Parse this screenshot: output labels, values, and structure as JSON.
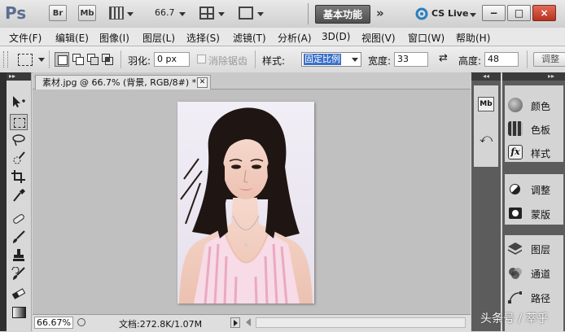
{
  "app": {
    "logo": "Ps",
    "bridge_label": "Br",
    "minibridge_label": "Mb",
    "zoom_value": "66.7",
    "workspace_label": "基本功能",
    "more_glyph": "»",
    "cs_live_label": "CS Live",
    "window_controls": [
      "−",
      "□",
      "×"
    ]
  },
  "menu": [
    "文件(F)",
    "编辑(E)",
    "图像(I)",
    "图层(L)",
    "选择(S)",
    "滤镜(T)",
    "分析(A)",
    "3D(D)",
    "视图(V)",
    "窗口(W)",
    "帮助(H)"
  ],
  "options": {
    "feather_label": "羽化:",
    "feather_value": "0 px",
    "antialias_label": "消除锯齿",
    "style_label": "样式:",
    "style_value": "固定比例",
    "width_label": "宽度:",
    "width_value": "33",
    "height_label": "高度:",
    "height_value": "48",
    "refine_label": "调整"
  },
  "document": {
    "tab_title": "素材.jpg @ 66.7% (背景, RGB/8#) *",
    "zoom": "66.67%",
    "doc_info": "文档:272.8K/1.07M"
  },
  "panels": {
    "items": [
      "颜色",
      "色板",
      "样式",
      "调整",
      "蒙版",
      "图层",
      "通道",
      "路径"
    ]
  },
  "watermark": "头条号 / 萃乎",
  "colors": {
    "workspace_bg": "#5a5a5a",
    "panel_dark": "#5c5c5c",
    "canvas_bg": "#c0c0c0",
    "close_red": "#c23a2a"
  }
}
